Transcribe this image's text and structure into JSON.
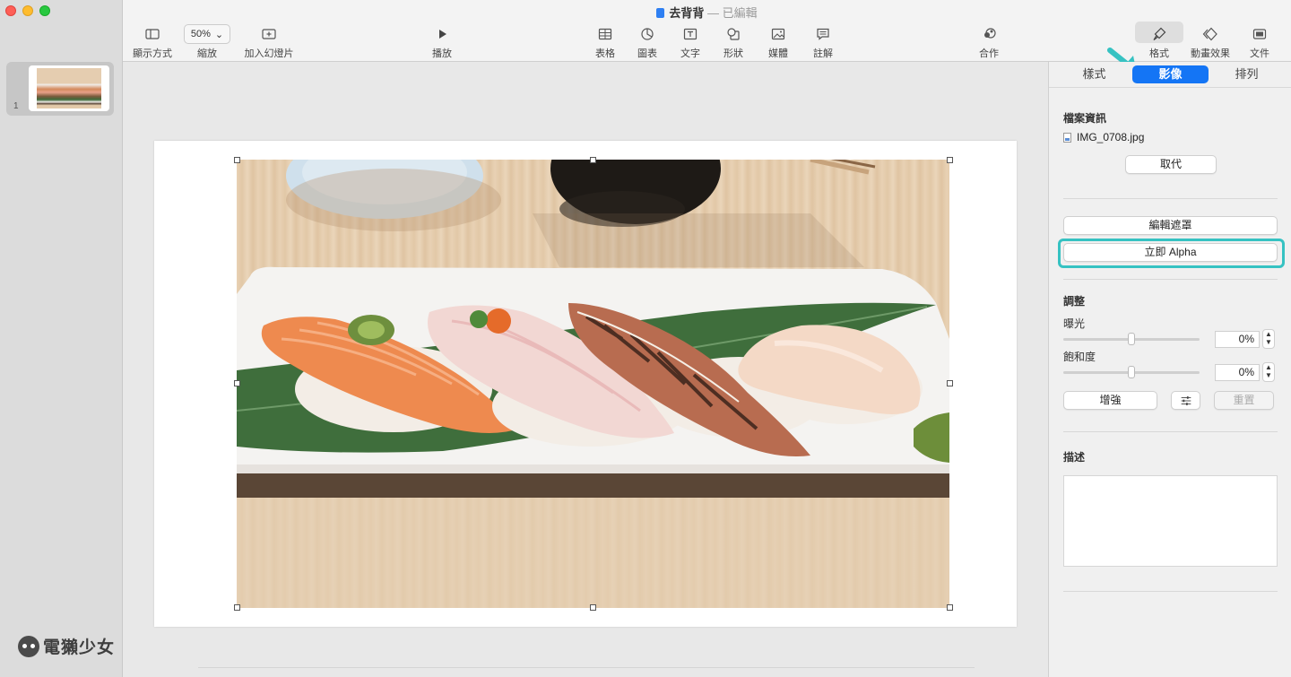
{
  "window": {
    "title": "去背背",
    "status": "已編輯"
  },
  "toolbar": {
    "view_label": "顯示方式",
    "zoom_value": "50%",
    "zoom_label": "縮放",
    "add_slide_label": "加入幻燈片",
    "play_label": "播放",
    "table_label": "表格",
    "chart_label": "圖表",
    "text_label": "文字",
    "shape_label": "形狀",
    "media_label": "媒體",
    "comment_label": "註解",
    "collaborate_label": "合作",
    "format_label": "格式",
    "animate_label": "動畫效果",
    "document_label": "文件"
  },
  "navigator": {
    "slides": [
      {
        "number": "1"
      }
    ]
  },
  "inspector": {
    "tabs": [
      {
        "label": "樣式",
        "active": false
      },
      {
        "label": "影像",
        "active": true
      },
      {
        "label": "排列",
        "active": false
      }
    ],
    "file_info": {
      "heading": "檔案資訊",
      "filename": "IMG_0708.jpg",
      "replace_label": "取代"
    },
    "edit_mask_label": "編輯遮罩",
    "instant_alpha_label": "立即 Alpha",
    "adjust": {
      "heading": "調整",
      "exposure": {
        "label": "曝光",
        "value": "0%",
        "level": 0.5
      },
      "saturation": {
        "label": "飽和度",
        "value": "0%",
        "level": 0.5
      },
      "enhance_label": "增強",
      "reset_label": "重置"
    },
    "description": {
      "heading": "描述",
      "text": ""
    }
  },
  "watermark": {
    "text": "電獺少女"
  },
  "colors": {
    "accent": "#1475f5",
    "highlight": "#36c2c2"
  }
}
